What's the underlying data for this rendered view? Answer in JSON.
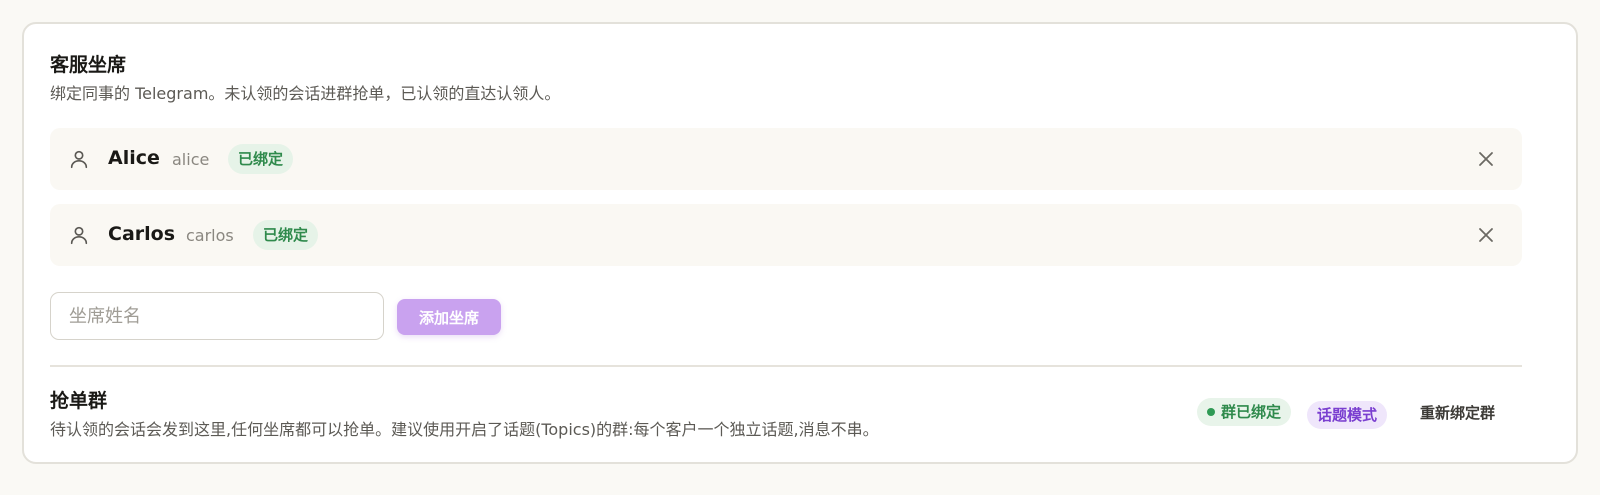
{
  "seats_section": {
    "title": "客服坐席",
    "description": "绑定同事的 Telegram。未认领的会话进群抢单，已认领的直达认领人。",
    "seats": [
      {
        "name": "Alice",
        "handle": "alice",
        "status": "已绑定",
        "icon": "user-icon"
      },
      {
        "name": "Carlos",
        "handle": "carlos",
        "status": "已绑定",
        "icon": "user-icon"
      }
    ],
    "input_placeholder": "坐席姓名",
    "input_value": "",
    "add_button": "添加坐席"
  },
  "group_section": {
    "title": "抢单群",
    "description": "待认领的会话会发到这里,任何坐席都可以抢单。建议使用开启了话题(Topics)的群:每个客户一个独立话题,消息不串。",
    "status_badge": "群已绑定",
    "mode_badge": "话题模式",
    "rebind_button": "重新绑定群"
  },
  "colors": {
    "accent": "#c9a2ef",
    "success": "#2f8a4c",
    "topic": "#7a3fd0"
  }
}
